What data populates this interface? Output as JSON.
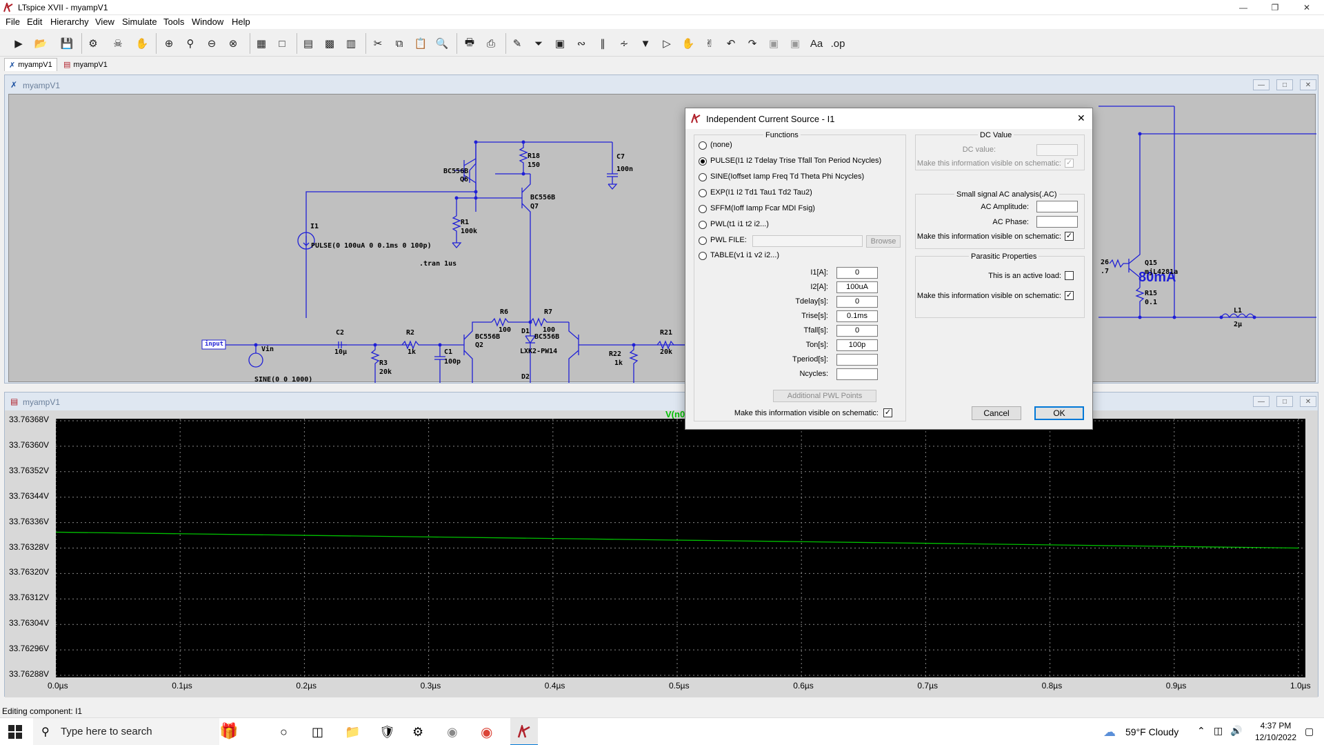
{
  "app": {
    "title": "LTspice XVII - myampV1",
    "menus": [
      "File",
      "Edit",
      "Hierarchy",
      "View",
      "Simulate",
      "Tools",
      "Window",
      "Help"
    ]
  },
  "doc_tabs": [
    "myampV1",
    "myampV1"
  ],
  "schematic": {
    "window_title": "myampV1",
    "labels": {
      "q6_model": "BC556B",
      "q6": "Q6",
      "r18": "R18",
      "r18_val": "150",
      "c7": "C7",
      "c7_val": "100n",
      "q7_model": "BC556B",
      "q7": "Q7",
      "r1": "R1",
      "r1_val": "100k",
      "i1": "I1",
      "i1_value": "PULSE(0 100uA 0 0.1ms 0 100p)",
      "tran": ".tran 1us",
      "input": "input",
      "vin": "Vin",
      "vin_value": "SINE(0 0 1000)",
      "c2": "C2",
      "c2_val": "10µ",
      "r3": "R3",
      "r3_val": "20k",
      "r2": "R2",
      "r2_val": "1k",
      "c1": "C1",
      "c1_val": "100p",
      "q2_model": "BC556B",
      "q2": "Q2",
      "r6": "R6",
      "r6_val": "100",
      "r7": "R7",
      "r7_val": "100",
      "d1": "D1",
      "d1_model": "LXK2-PW14",
      "q3_model": "BC556B",
      "d2": "D2",
      "r22": "R22",
      "r22_val": "1k",
      "r21": "R21",
      "r21_val": "20k",
      "current_label": "80mA",
      "q15": "Q15",
      "q15_model": "mjL4281a",
      "r26_partial": "26",
      "r26_val_partial": ".7",
      "r15": "R15",
      "r15_val": "0.1",
      "l1": "L1",
      "l1_val": "2µ"
    }
  },
  "waveform": {
    "window_title": "myampV1",
    "trace_label": "V(n0",
    "y_ticks": [
      "33.76368V",
      "33.76360V",
      "33.76352V",
      "33.76344V",
      "33.76336V",
      "33.76328V",
      "33.76320V",
      "33.76312V",
      "33.76304V",
      "33.76296V",
      "33.76288V"
    ],
    "x_ticks": [
      "0.0µs",
      "0.1µs",
      "0.2µs",
      "0.3µs",
      "0.4µs",
      "0.5µs",
      "0.6µs",
      "0.7µs",
      "0.8µs",
      "0.9µs",
      "1.0µs"
    ],
    "trace_color": "#00c000"
  },
  "chart_data": {
    "type": "line",
    "title": "",
    "xlabel": "",
    "ylabel": "",
    "xlim": [
      0,
      1.0
    ],
    "ylim": [
      33.76288,
      33.76368
    ],
    "grid": true,
    "series": [
      {
        "name": "V(n0",
        "x": [
          0.0,
          0.1,
          0.2,
          0.3,
          0.4,
          0.5,
          0.6,
          0.7,
          0.8,
          0.9,
          1.0
        ],
        "values": [
          33.76333,
          33.763325,
          33.76332,
          33.763315,
          33.76331,
          33.763305,
          33.7633,
          33.763295,
          33.76329,
          33.763285,
          33.76328
        ]
      }
    ]
  },
  "dialog": {
    "title": "Independent Current Source - I1",
    "functions_title": "Functions",
    "functions": [
      {
        "label": "(none)",
        "selected": false
      },
      {
        "label": "PULSE(I1 I2 Tdelay Trise Tfall Ton Period Ncycles)",
        "selected": true
      },
      {
        "label": "SINE(Ioffset Iamp Freq Td Theta Phi Ncycles)",
        "selected": false
      },
      {
        "label": "EXP(I1 I2 Td1 Tau1 Td2 Tau2)",
        "selected": false
      },
      {
        "label": "SFFM(Ioff Iamp Fcar MDI Fsig)",
        "selected": false
      },
      {
        "label": "PWL(t1 i1 t2 i2...)",
        "selected": false
      },
      {
        "label": "PWL FILE:",
        "selected": false
      },
      {
        "label": "TABLE(v1 i1 v2 i2...)",
        "selected": false
      }
    ],
    "browse_label": "Browse",
    "params": [
      {
        "label": "I1[A]:",
        "value": "0"
      },
      {
        "label": "I2[A]:",
        "value": "100uA"
      },
      {
        "label": "Tdelay[s]:",
        "value": "0"
      },
      {
        "label": "Trise[s]:",
        "value": "0.1ms"
      },
      {
        "label": "Tfall[s]:",
        "value": "0"
      },
      {
        "label": "Ton[s]:",
        "value": "100p"
      },
      {
        "label": "Tperiod[s]:",
        "value": ""
      },
      {
        "label": "Ncycles:",
        "value": ""
      }
    ],
    "additional_pwl": "Additional PWL Points",
    "visible_left": "Make this information visible on schematic:",
    "dc": {
      "title": "DC Value",
      "dc_value_label": "DC value:",
      "visible_label": "Make this information visible on schematic:"
    },
    "ac": {
      "title": "Small signal AC analysis(.AC)",
      "amplitude_label": "AC Amplitude:",
      "phase_label": "AC Phase:",
      "visible_label": "Make this information visible on schematic:"
    },
    "parasitic": {
      "title": "Parasitic Properties",
      "active_load_label": "This is an active load:",
      "visible_label": "Make this information visible on schematic:"
    },
    "cancel": "Cancel",
    "ok": "OK"
  },
  "status": "Editing component: I1",
  "taskbar": {
    "search_placeholder": "Type here to search",
    "weather": "59°F  Cloudy",
    "time": "4:37 PM",
    "date": "12/10/2022"
  }
}
